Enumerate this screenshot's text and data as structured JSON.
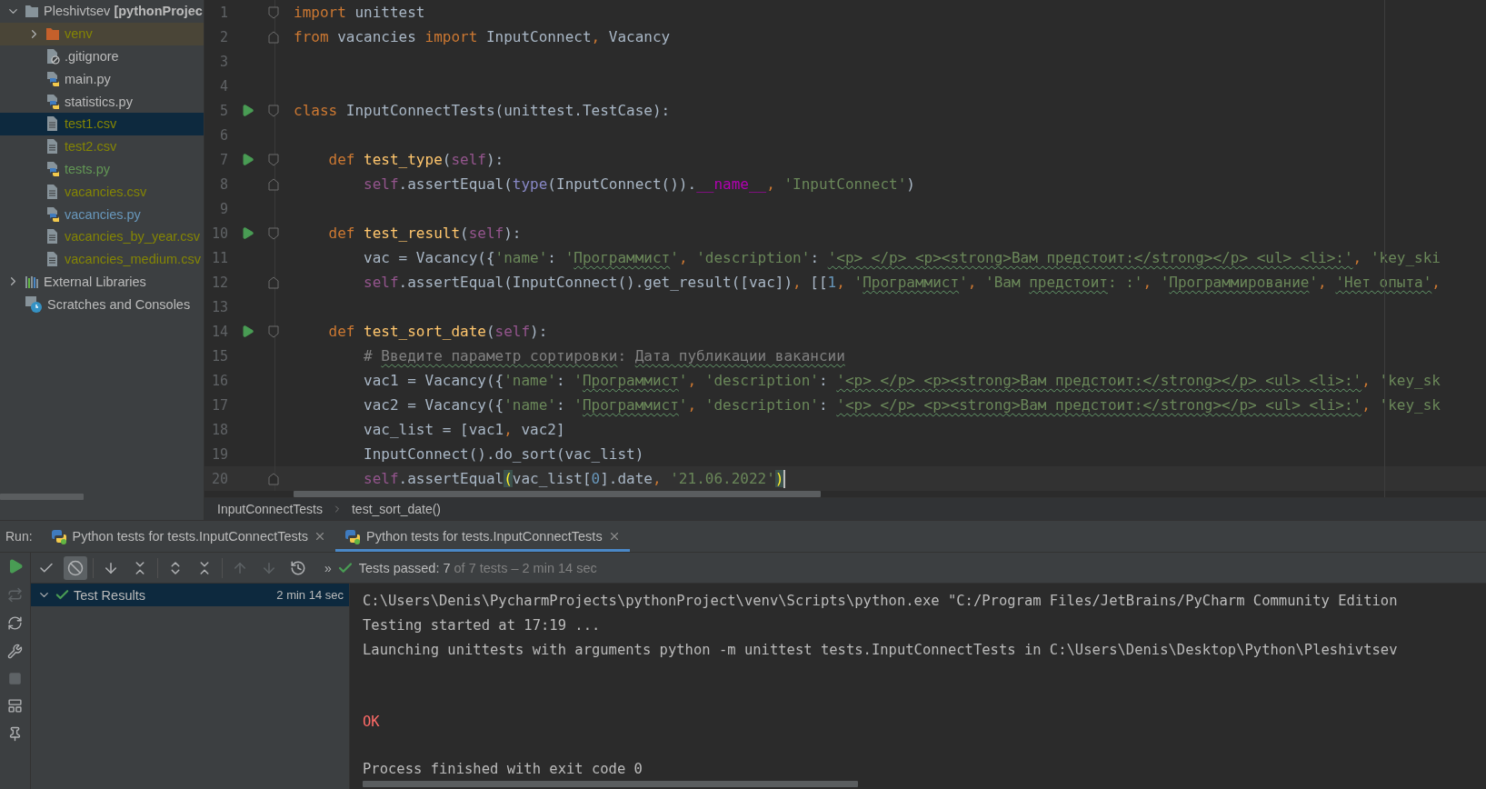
{
  "project_tree": [
    {
      "label": "Pleshivtsev **[pythonProjec**",
      "kind": "folder",
      "expanded": true,
      "selected": false,
      "tinted": false,
      "color": "#bbbbbb",
      "children": [
        {
          "label": "venv",
          "kind": "excluded",
          "expanded": false,
          "selected": false,
          "tinted": true,
          "color": "#848504"
        },
        {
          "label": ".gitignore",
          "kind": "ignore",
          "selected": false,
          "tinted": false,
          "color": "#bbbbbb"
        },
        {
          "label": "main.py",
          "kind": "python",
          "selected": false,
          "tinted": false,
          "color": "#bbbbbb"
        },
        {
          "label": "statistics.py",
          "kind": "python",
          "selected": false,
          "tinted": false,
          "color": "#bbbbbb"
        },
        {
          "label": "test1.csv",
          "kind": "text",
          "selected": true,
          "tinted": false,
          "color": "#848504"
        },
        {
          "label": "test2.csv",
          "kind": "text",
          "selected": false,
          "tinted": false,
          "color": "#848504"
        },
        {
          "label": "tests.py",
          "kind": "python",
          "selected": false,
          "tinted": false,
          "color": "#629755"
        },
        {
          "label": "vacancies.csv",
          "kind": "text",
          "selected": false,
          "tinted": false,
          "color": "#848504"
        },
        {
          "label": "vacancies.py",
          "kind": "python",
          "selected": false,
          "tinted": false,
          "color": "#6897bb"
        },
        {
          "label": "vacancies_by_year.csv",
          "kind": "text",
          "selected": false,
          "tinted": false,
          "color": "#848504"
        },
        {
          "label": "vacancies_medium.csv",
          "kind": "text",
          "selected": false,
          "tinted": false,
          "color": "#848504"
        }
      ]
    },
    {
      "label": "External Libraries",
      "kind": "library",
      "expanded": false,
      "selected": false,
      "tinted": false,
      "color": "#bbbbbb"
    },
    {
      "label": "Scratches and Consoles",
      "kind": "scratches",
      "selected": false,
      "tinted": false,
      "color": "#bbbbbb"
    }
  ],
  "editor": {
    "lines": [
      {
        "number": "1",
        "run": false,
        "fold_start": true,
        "fold_end": false,
        "current": false,
        "tokens": [
          {
            "kind": "keyword",
            "text": "import"
          },
          {
            "kind": "plain",
            "text": " unittest"
          }
        ]
      },
      {
        "number": "2",
        "run": false,
        "fold_start": false,
        "fold_end": true,
        "current": false,
        "tokens": [
          {
            "kind": "keyword",
            "text": "from"
          },
          {
            "kind": "plain",
            "text": " vacancies "
          },
          {
            "kind": "keyword",
            "text": "import"
          },
          {
            "kind": "plain",
            "text": " InputConnect"
          },
          {
            "kind": "punct",
            "text": ", "
          },
          {
            "kind": "plain",
            "text": "Vacancy"
          }
        ]
      },
      {
        "number": "3",
        "run": false,
        "fold_start": false,
        "fold_end": false,
        "current": false
      },
      {
        "number": "4",
        "run": false,
        "fold_start": false,
        "fold_end": false,
        "current": false
      },
      {
        "number": "5",
        "run": true,
        "fold_start": true,
        "fold_end": false,
        "current": false,
        "tokens": [
          {
            "kind": "keyword",
            "text": "class"
          },
          {
            "kind": "plain",
            "text": " InputConnectTests(unittest.TestCase):"
          }
        ]
      },
      {
        "number": "6",
        "run": false,
        "fold_start": false,
        "fold_end": false,
        "current": false
      },
      {
        "number": "7",
        "run": true,
        "fold_start": true,
        "fold_end": false,
        "current": false,
        "tokens": [
          {
            "kind": "keyword",
            "text": "    def"
          },
          {
            "kind": "function",
            "text": " test_type"
          },
          {
            "kind": "plain",
            "text": "("
          },
          {
            "kind": "self",
            "text": "self"
          },
          {
            "kind": "plain",
            "text": "):"
          }
        ]
      },
      {
        "number": "8",
        "run": false,
        "fold_start": false,
        "fold_end": true,
        "current": false,
        "tokens": [
          {
            "kind": "self",
            "text": "        self"
          },
          {
            "kind": "plain",
            "text": ".assertEqual("
          },
          {
            "kind": "builtin",
            "text": "type"
          },
          {
            "kind": "plain",
            "text": "(InputConnect())."
          },
          {
            "kind": "magic",
            "text": "__name__"
          },
          {
            "kind": "punct",
            "text": ", "
          },
          {
            "kind": "string",
            "text": "'InputConnect'"
          },
          {
            "kind": "plain",
            "text": ")"
          }
        ]
      },
      {
        "number": "9",
        "run": false,
        "fold_start": false,
        "fold_end": false,
        "current": false
      },
      {
        "number": "10",
        "run": true,
        "fold_start": true,
        "fold_end": false,
        "current": false,
        "tokens": [
          {
            "kind": "keyword",
            "text": "    def"
          },
          {
            "kind": "function",
            "text": " test_result"
          },
          {
            "kind": "plain",
            "text": "("
          },
          {
            "kind": "self",
            "text": "self"
          },
          {
            "kind": "plain",
            "text": "):"
          }
        ]
      },
      {
        "number": "11",
        "run": false,
        "fold_start": false,
        "fold_end": false,
        "current": false,
        "tokens": [
          {
            "kind": "plain",
            "text": "        vac = Vacancy({"
          },
          {
            "kind": "string",
            "text": "'name'"
          },
          {
            "kind": "plain",
            "text": ": "
          },
          {
            "kind": "string",
            "text": "'"
          },
          {
            "kind": "string",
            "text": "Программист",
            "typo": true
          },
          {
            "kind": "string",
            "text": "'"
          },
          {
            "kind": "punct",
            "text": ", "
          },
          {
            "kind": "string",
            "text": "'description'"
          },
          {
            "kind": "plain",
            "text": ": "
          },
          {
            "kind": "string",
            "text": "'<p> </p> <p><strong>Вам предстоит:</strong></p> <ul> <li>:'",
            "typo": true
          },
          {
            "kind": "punct",
            "text": ", "
          },
          {
            "kind": "string",
            "text": "'key_ski"
          }
        ]
      },
      {
        "number": "12",
        "run": false,
        "fold_start": false,
        "fold_end": true,
        "current": false,
        "tokens": [
          {
            "kind": "self",
            "text": "        self"
          },
          {
            "kind": "plain",
            "text": ".assertEqual(InputConnect().get_result([vac])"
          },
          {
            "kind": "punct",
            "text": ", "
          },
          {
            "kind": "plain",
            "text": "[["
          },
          {
            "kind": "number",
            "text": "1"
          },
          {
            "kind": "punct",
            "text": ", "
          },
          {
            "kind": "string",
            "text": "'"
          },
          {
            "kind": "string",
            "text": "Программист",
            "typo": true
          },
          {
            "kind": "string",
            "text": "'"
          },
          {
            "kind": "punct",
            "text": ", "
          },
          {
            "kind": "string",
            "text": "'Вам "
          },
          {
            "kind": "string",
            "text": "предстоит",
            "typo": true
          },
          {
            "kind": "string",
            "text": ": :'"
          },
          {
            "kind": "punct",
            "text": ", "
          },
          {
            "kind": "string",
            "text": "'"
          },
          {
            "kind": "string",
            "text": "Программирование",
            "typo": true
          },
          {
            "kind": "string",
            "text": "'"
          },
          {
            "kind": "punct",
            "text": ", "
          },
          {
            "kind": "string",
            "text": "'Нет опыта'",
            "typo": true
          },
          {
            "kind": "punct",
            "text": ","
          }
        ]
      },
      {
        "number": "13",
        "run": false,
        "fold_start": false,
        "fold_end": false,
        "current": false
      },
      {
        "number": "14",
        "run": true,
        "fold_start": true,
        "fold_end": false,
        "current": false,
        "tokens": [
          {
            "kind": "keyword",
            "text": "    def"
          },
          {
            "kind": "function",
            "text": " test_sort_date"
          },
          {
            "kind": "plain",
            "text": "("
          },
          {
            "kind": "self",
            "text": "self"
          },
          {
            "kind": "plain",
            "text": "):"
          }
        ]
      },
      {
        "number": "15",
        "run": false,
        "fold_start": false,
        "fold_end": false,
        "current": false,
        "tokens": [
          {
            "kind": "comment",
            "text": "        # "
          },
          {
            "kind": "comment",
            "text": "Введите параметр сортировки",
            "typo": true
          },
          {
            "kind": "comment",
            "text": ": "
          },
          {
            "kind": "comment",
            "text": "Дата публикации вакансии",
            "typo": true
          }
        ]
      },
      {
        "number": "16",
        "run": false,
        "fold_start": false,
        "fold_end": false,
        "current": false,
        "tokens": [
          {
            "kind": "plain",
            "text": "        vac1 = Vacancy({"
          },
          {
            "kind": "string",
            "text": "'name'"
          },
          {
            "kind": "plain",
            "text": ": "
          },
          {
            "kind": "string",
            "text": "'"
          },
          {
            "kind": "string",
            "text": "Программист",
            "typo": true
          },
          {
            "kind": "string",
            "text": "'"
          },
          {
            "kind": "punct",
            "text": ", "
          },
          {
            "kind": "string",
            "text": "'description'"
          },
          {
            "kind": "plain",
            "text": ": "
          },
          {
            "kind": "string",
            "text": "'<p> </p> <p><strong>Вам предстоит:</strong></p> <ul> <li>:'",
            "typo": true
          },
          {
            "kind": "punct",
            "text": ", "
          },
          {
            "kind": "string",
            "text": "'key_sk"
          }
        ]
      },
      {
        "number": "17",
        "run": false,
        "fold_start": false,
        "fold_end": false,
        "current": false,
        "tokens": [
          {
            "kind": "plain",
            "text": "        vac2 = Vacancy({"
          },
          {
            "kind": "string",
            "text": "'name'"
          },
          {
            "kind": "plain",
            "text": ": "
          },
          {
            "kind": "string",
            "text": "'"
          },
          {
            "kind": "string",
            "text": "Программист",
            "typo": true
          },
          {
            "kind": "string",
            "text": "'"
          },
          {
            "kind": "punct",
            "text": ", "
          },
          {
            "kind": "string",
            "text": "'description'"
          },
          {
            "kind": "plain",
            "text": ": "
          },
          {
            "kind": "string",
            "text": "'<p> </p> <p><strong>Вам предстоит:</strong></p> <ul> <li>:'",
            "typo": true
          },
          {
            "kind": "punct",
            "text": ", "
          },
          {
            "kind": "string",
            "text": "'key_sk"
          }
        ]
      },
      {
        "number": "18",
        "run": false,
        "fold_start": false,
        "fold_end": false,
        "current": false,
        "tokens": [
          {
            "kind": "plain",
            "text": "        vac_list = [vac1"
          },
          {
            "kind": "punct",
            "text": ", "
          },
          {
            "kind": "plain",
            "text": "vac2]"
          }
        ]
      },
      {
        "number": "19",
        "run": false,
        "fold_start": false,
        "fold_end": false,
        "current": false,
        "tokens": [
          {
            "kind": "plain",
            "text": "        InputConnect().do_sort(vac_list)"
          }
        ]
      },
      {
        "number": "20",
        "run": false,
        "fold_start": false,
        "fold_end": true,
        "current": true,
        "tokens": [
          {
            "kind": "self",
            "text": "        self"
          },
          {
            "kind": "plain",
            "text": ".assertEqual"
          },
          {
            "kind": "brace",
            "text": "("
          },
          {
            "kind": "plain",
            "text": "vac_list["
          },
          {
            "kind": "number",
            "text": "0"
          },
          {
            "kind": "plain",
            "text": "].date"
          },
          {
            "kind": "punct",
            "text": ", "
          },
          {
            "kind": "string",
            "text": "'21.06.2022'"
          },
          {
            "kind": "brace",
            "text": ")"
          }
        ]
      }
    ]
  },
  "breadcrumbs": [
    "InputConnectTests",
    "test_sort_date()"
  ],
  "run_panel": {
    "label": "Run:",
    "tabs": [
      {
        "label": "Python tests for tests.InputConnectTests",
        "selected": false
      },
      {
        "label": "Python tests for tests.InputConnectTests",
        "selected": true
      }
    ],
    "passed_filter_on": false,
    "ignored_filter_on": true,
    "more": "»",
    "status": {
      "passed": "Tests passed: 7",
      "detail": "of 7 tests – 2 min 14 sec"
    },
    "tests": [
      {
        "label": "Test Results",
        "duration": "2 min 14 sec",
        "passed": true,
        "expanded": true,
        "selected": true
      }
    ],
    "console": [
      {
        "kind": "command",
        "text": "C:\\Users\\Denis\\PycharmProjects\\pythonProject\\venv\\Scripts\\python.exe \"C:/Program Files/JetBrains/PyCharm Community Edition"
      },
      {
        "kind": "info",
        "text": "Testing started at 17:19 ..."
      },
      {
        "kind": "info",
        "text": "Launching unittests with arguments python -m unittest tests.InputConnectTests in C:\\Users\\Denis\\Desktop\\Python\\Pleshivtsev"
      },
      {
        "kind": "result",
        "text": "OK"
      },
      {
        "kind": "exit",
        "text": "Process finished with exit code 0"
      }
    ]
  }
}
